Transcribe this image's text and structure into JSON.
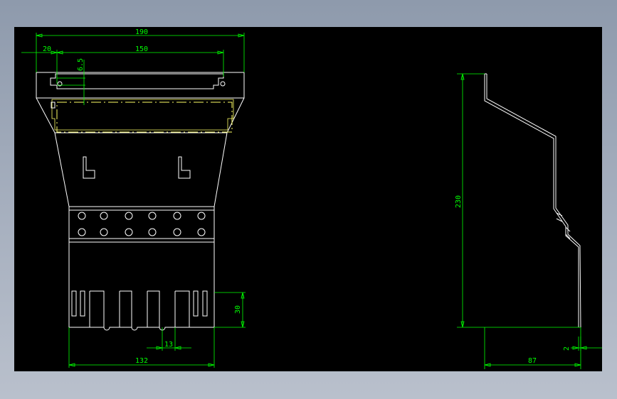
{
  "drawing": {
    "background": "#000000",
    "line_color": "#ffffff",
    "dimension_color": "#00ff00",
    "centerline_color": "#ffff66"
  },
  "front_view": {
    "dims": {
      "overall_width": "190",
      "inner_width": "150",
      "edge_offset": "20",
      "slot_depth": "6.5",
      "tab_height": "30",
      "tab_width": "13",
      "bottom_width": "132"
    }
  },
  "side_view": {
    "dims": {
      "height": "230",
      "depth": "87",
      "thickness": "2"
    }
  }
}
